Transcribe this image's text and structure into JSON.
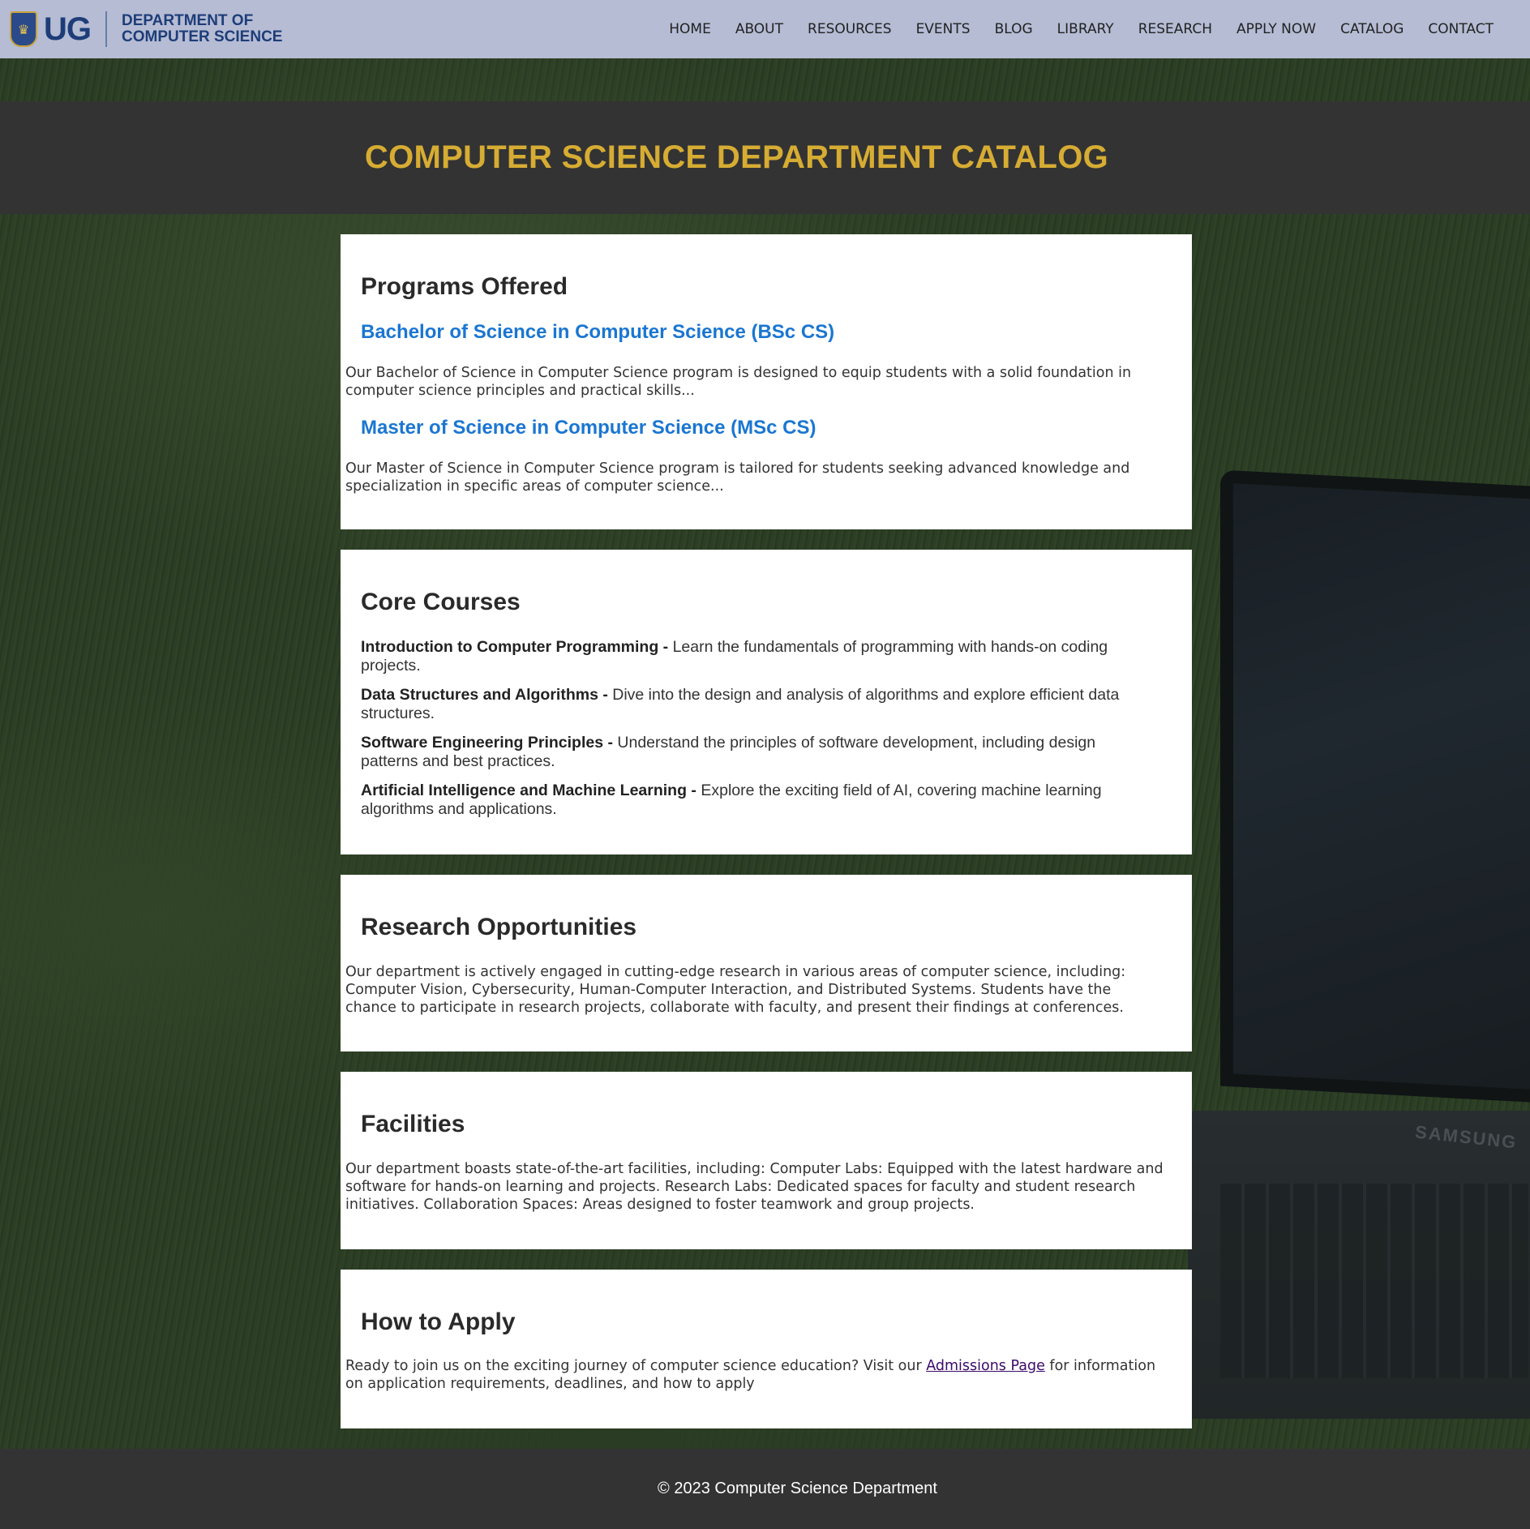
{
  "header": {
    "logo_text": "UG",
    "department_line1": "DEPARTMENT OF",
    "department_line2": "COMPUTER SCIENCE",
    "nav": [
      "HOME",
      "ABOUT",
      "RESOURCES",
      "EVENTS",
      "BLOG",
      "LIBRARY",
      "RESEARCH",
      "APPLY NOW",
      "CATALOG",
      "CONTACT"
    ]
  },
  "banner": {
    "title": "COMPUTER SCIENCE DEPARTMENT CATALOG"
  },
  "programs": {
    "heading": "Programs Offered",
    "items": [
      {
        "title": "Bachelor of Science in Computer Science (BSc CS)",
        "description": "Our Bachelor of Science in Computer Science program is designed to equip students with a solid foundation in computer science principles and practical skills..."
      },
      {
        "title": "Master of Science in Computer Science (MSc CS)",
        "description": "Our Master of Science in Computer Science program is tailored for students seeking advanced knowledge and specialization in specific areas of computer science..."
      }
    ]
  },
  "core_courses": {
    "heading": "Core Courses",
    "items": [
      {
        "name": "Introduction to Computer Programming -",
        "description": " Learn the fundamentals of programming with hands-on coding projects."
      },
      {
        "name": "Data Structures and Algorithms -",
        "description": " Dive into the design and analysis of algorithms and explore efficient data structures."
      },
      {
        "name": "Software Engineering Principles -",
        "description": " Understand the principles of software development, including design patterns and best practices."
      },
      {
        "name": "Artificial Intelligence and Machine Learning -",
        "description": " Explore the exciting field of AI, covering machine learning algorithms and applications."
      }
    ]
  },
  "research": {
    "heading": "Research Opportunities",
    "text": "Our department is actively engaged in cutting-edge research in various areas of computer science, including: Computer Vision, Cybersecurity, Human-Computer Interaction, and Distributed Systems. Students have the chance to participate in research projects, collaborate with faculty, and present their findings at conferences."
  },
  "facilities": {
    "heading": "Facilities",
    "text": "Our department boasts state-of-the-art facilities, including: Computer Labs: Equipped with the latest hardware and software for hands-on learning and projects. Research Labs: Dedicated spaces for faculty and student research initiatives. Collaboration Spaces: Areas designed to foster teamwork and group projects."
  },
  "apply": {
    "heading": "How to Apply",
    "text_before": "Ready to join us on the exciting journey of computer science education? Visit our ",
    "link_text": "Admissions Page",
    "text_after": " for information on application requirements, deadlines, and how to apply"
  },
  "background": {
    "brand_text": "SAMSUNG"
  },
  "footer": {
    "copyright": "© 2023 Computer Science Department"
  },
  "colors": {
    "header_bg": "#b5bcd4",
    "banner_bg": "#333333",
    "title_gold": "#d6ac33",
    "program_blue": "#1a76d2",
    "link_purple": "#3b0a6b"
  }
}
